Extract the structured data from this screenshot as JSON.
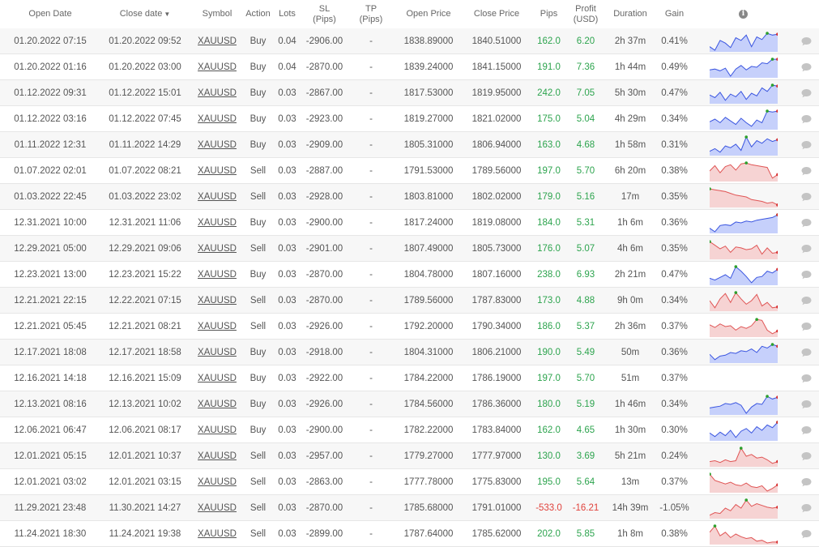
{
  "headers": {
    "open_date": "Open Date",
    "close_date": "Close date",
    "sort_arrow": "▼",
    "symbol": "Symbol",
    "action": "Action",
    "lots": "Lots",
    "sl": "SL",
    "sl_unit": "(Pips)",
    "tp": "TP",
    "tp_unit": "(Pips)",
    "open_price": "Open Price",
    "close_price": "Close Price",
    "pips": "Pips",
    "profit": "Profit",
    "profit_unit": "(USD)",
    "duration": "Duration",
    "gain": "Gain",
    "info_icon": "i"
  },
  "colors": {
    "profit_positive": "#2da44e",
    "profit_negative": "#e0413b",
    "buy_spark_line": "#3a55e0",
    "buy_spark_fill": "#c6d0fb",
    "sell_spark_line": "#e05555",
    "sell_spark_fill": "#f6d3d3",
    "spark_max_point": "#2ca02c",
    "spark_end_point": "#d62728",
    "comment_icon": "#c4c4c4"
  },
  "trades": [
    {
      "open": "01.20.2022 07:15",
      "close": "01.20.2022 09:52",
      "symbol": "XAUUSD",
      "action": "Buy",
      "lots": "0.04",
      "sl": "-2906.00",
      "tp": "-",
      "open_price": "1838.89000",
      "close_price": "1840.51000",
      "pips": "162.0",
      "profit": "6.20",
      "duration": "2h 37m",
      "gain": "0.41%",
      "spark": [
        0.2,
        0.0,
        0.55,
        0.4,
        0.15,
        0.7,
        0.55,
        0.85,
        0.2,
        0.75,
        0.6,
        0.95,
        0.85,
        0.9
      ]
    },
    {
      "open": "01.20.2022 01:16",
      "close": "01.20.2022 03:00",
      "symbol": "XAUUSD",
      "action": "Buy",
      "lots": "0.04",
      "sl": "-2870.00",
      "tp": "-",
      "open_price": "1839.24000",
      "close_price": "1841.15000",
      "pips": "191.0",
      "profit": "7.36",
      "duration": "1h 44m",
      "gain": "0.49%",
      "spark": [
        0.35,
        0.4,
        0.3,
        0.45,
        0.0,
        0.4,
        0.6,
        0.35,
        0.55,
        0.5,
        0.75,
        0.7,
        0.95,
        0.95
      ]
    },
    {
      "open": "01.12.2022 09:31",
      "close": "01.12.2022 15:01",
      "symbol": "XAUUSD",
      "action": "Buy",
      "lots": "0.03",
      "sl": "-2867.00",
      "tp": "-",
      "open_price": "1817.53000",
      "close_price": "1819.95000",
      "pips": "242.0",
      "profit": "7.05",
      "duration": "5h 30m",
      "gain": "0.47%",
      "spark": [
        0.4,
        0.25,
        0.55,
        0.1,
        0.45,
        0.3,
        0.6,
        0.15,
        0.5,
        0.35,
        0.8,
        0.6,
        0.95,
        0.9
      ]
    },
    {
      "open": "01.12.2022 03:16",
      "close": "01.12.2022 07:45",
      "symbol": "XAUUSD",
      "action": "Buy",
      "lots": "0.03",
      "sl": "-2923.00",
      "tp": "-",
      "open_price": "1819.27000",
      "close_price": "1821.02000",
      "pips": "175.0",
      "profit": "5.04",
      "duration": "4h 29m",
      "gain": "0.34%",
      "spark": [
        0.35,
        0.5,
        0.3,
        0.6,
        0.4,
        0.2,
        0.55,
        0.3,
        0.1,
        0.45,
        0.3,
        0.95,
        0.9,
        0.95
      ]
    },
    {
      "open": "01.11.2022 12:31",
      "close": "01.11.2022 14:29",
      "symbol": "XAUUSD",
      "action": "Buy",
      "lots": "0.03",
      "sl": "-2909.00",
      "tp": "-",
      "open_price": "1805.31000",
      "close_price": "1806.94000",
      "pips": "163.0",
      "profit": "4.68",
      "duration": "1h 58m",
      "gain": "0.31%",
      "spark": [
        0.15,
        0.3,
        0.1,
        0.45,
        0.35,
        0.55,
        0.2,
        0.95,
        0.4,
        0.75,
        0.6,
        0.85,
        0.7,
        0.8
      ]
    },
    {
      "open": "01.07.2022 02:01",
      "close": "01.07.2022 08:21",
      "symbol": "XAUUSD",
      "action": "Sell",
      "lots": "0.03",
      "sl": "-2887.00",
      "tp": "-",
      "open_price": "1791.53000",
      "close_price": "1789.56000",
      "pips": "197.0",
      "profit": "5.70",
      "duration": "6h 20m",
      "gain": "0.38%",
      "spark": [
        0.5,
        0.8,
        0.4,
        0.75,
        0.85,
        0.55,
        0.9,
        0.95,
        0.85,
        0.8,
        0.75,
        0.7,
        0.1,
        0.3
      ]
    },
    {
      "open": "01.03.2022 22:45",
      "close": "01.03.2022 23:02",
      "symbol": "XAUUSD",
      "action": "Sell",
      "lots": "0.03",
      "sl": "-2928.00",
      "tp": "-",
      "open_price": "1803.81000",
      "close_price": "1802.02000",
      "pips": "179.0",
      "profit": "5.16",
      "duration": "17m",
      "gain": "0.35%",
      "spark": [
        0.95,
        0.9,
        0.85,
        0.8,
        0.7,
        0.6,
        0.55,
        0.5,
        0.35,
        0.3,
        0.25,
        0.15,
        0.2,
        0.05
      ]
    },
    {
      "open": "12.31.2021 10:00",
      "close": "12.31.2021 11:06",
      "symbol": "XAUUSD",
      "action": "Buy",
      "lots": "0.03",
      "sl": "-2900.00",
      "tp": "-",
      "open_price": "1817.24000",
      "close_price": "1819.08000",
      "pips": "184.0",
      "profit": "5.31",
      "duration": "1h 6m",
      "gain": "0.36%",
      "spark": [
        0.2,
        0.0,
        0.35,
        0.4,
        0.35,
        0.55,
        0.5,
        0.6,
        0.55,
        0.65,
        0.7,
        0.75,
        0.8,
        0.95
      ]
    },
    {
      "open": "12.29.2021 05:00",
      "close": "12.29.2021 09:06",
      "symbol": "XAUUSD",
      "action": "Sell",
      "lots": "0.03",
      "sl": "-2901.00",
      "tp": "-",
      "open_price": "1807.49000",
      "close_price": "1805.73000",
      "pips": "176.0",
      "profit": "5.07",
      "duration": "4h 6m",
      "gain": "0.35%",
      "spark": [
        0.9,
        0.7,
        0.5,
        0.65,
        0.3,
        0.6,
        0.55,
        0.45,
        0.5,
        0.7,
        0.2,
        0.55,
        0.25,
        0.3
      ]
    },
    {
      "open": "12.23.2021 13:00",
      "close": "12.23.2021 15:22",
      "symbol": "XAUUSD",
      "action": "Buy",
      "lots": "0.03",
      "sl": "-2870.00",
      "tp": "-",
      "open_price": "1804.78000",
      "close_price": "1807.16000",
      "pips": "238.0",
      "profit": "6.93",
      "duration": "2h 21m",
      "gain": "0.47%",
      "spark": [
        0.3,
        0.2,
        0.35,
        0.5,
        0.3,
        0.95,
        0.7,
        0.4,
        0.05,
        0.35,
        0.4,
        0.7,
        0.6,
        0.8
      ]
    },
    {
      "open": "12.21.2021 22:15",
      "close": "12.22.2021 07:15",
      "symbol": "XAUUSD",
      "action": "Sell",
      "lots": "0.03",
      "sl": "-2870.00",
      "tp": "-",
      "open_price": "1789.56000",
      "close_price": "1787.83000",
      "pips": "173.0",
      "profit": "4.88",
      "duration": "9h 0m",
      "gain": "0.34%",
      "spark": [
        0.5,
        0.1,
        0.6,
        0.9,
        0.4,
        0.95,
        0.6,
        0.3,
        0.5,
        0.85,
        0.2,
        0.4,
        0.1,
        0.15
      ]
    },
    {
      "open": "12.21.2021 05:45",
      "close": "12.21.2021 08:21",
      "symbol": "XAUUSD",
      "action": "Sell",
      "lots": "0.03",
      "sl": "-2926.00",
      "tp": "-",
      "open_price": "1792.20000",
      "close_price": "1790.34000",
      "pips": "186.0",
      "profit": "5.37",
      "duration": "2h 36m",
      "gain": "0.37%",
      "spark": [
        0.6,
        0.45,
        0.65,
        0.5,
        0.55,
        0.3,
        0.5,
        0.4,
        0.55,
        0.9,
        0.85,
        0.3,
        0.1,
        0.25
      ]
    },
    {
      "open": "12.17.2021 18:08",
      "close": "12.17.2021 18:58",
      "symbol": "XAUUSD",
      "action": "Buy",
      "lots": "0.03",
      "sl": "-2918.00",
      "tp": "-",
      "open_price": "1804.31000",
      "close_price": "1806.21000",
      "pips": "190.0",
      "profit": "5.49",
      "duration": "50m",
      "gain": "0.36%",
      "spark": [
        0.4,
        0.1,
        0.3,
        0.35,
        0.5,
        0.45,
        0.6,
        0.55,
        0.7,
        0.5,
        0.85,
        0.75,
        0.95,
        0.85
      ]
    },
    {
      "open": "12.16.2021 14:18",
      "close": "12.16.2021 15:09",
      "symbol": "XAUUSD",
      "action": "Buy",
      "lots": "0.03",
      "sl": "-2922.00",
      "tp": "-",
      "open_price": "1784.22000",
      "close_price": "1786.19000",
      "pips": "197.0",
      "profit": "5.70",
      "duration": "51m",
      "gain": "0.37%",
      "spark": null
    },
    {
      "open": "12.13.2021 08:16",
      "close": "12.13.2021 10:02",
      "symbol": "XAUUSD",
      "action": "Buy",
      "lots": "0.03",
      "sl": "-2926.00",
      "tp": "-",
      "open_price": "1784.56000",
      "close_price": "1786.36000",
      "pips": "180.0",
      "profit": "5.19",
      "duration": "1h 46m",
      "gain": "0.34%",
      "spark": [
        0.3,
        0.35,
        0.4,
        0.55,
        0.5,
        0.6,
        0.45,
        0.0,
        0.35,
        0.55,
        0.5,
        0.95,
        0.8,
        0.9
      ]
    },
    {
      "open": "12.06.2021 06:47",
      "close": "12.06.2021 08:17",
      "symbol": "XAUUSD",
      "action": "Buy",
      "lots": "0.03",
      "sl": "-2900.00",
      "tp": "-",
      "open_price": "1782.22000",
      "close_price": "1783.84000",
      "pips": "162.0",
      "profit": "4.65",
      "duration": "1h 30m",
      "gain": "0.30%",
      "spark": [
        0.35,
        0.15,
        0.4,
        0.2,
        0.5,
        0.1,
        0.45,
        0.6,
        0.35,
        0.7,
        0.5,
        0.8,
        0.65,
        0.95
      ]
    },
    {
      "open": "12.01.2021 05:15",
      "close": "12.01.2021 10:37",
      "symbol": "XAUUSD",
      "action": "Sell",
      "lots": "0.03",
      "sl": "-2957.00",
      "tp": "-",
      "open_price": "1779.27000",
      "close_price": "1777.97000",
      "pips": "130.0",
      "profit": "3.69",
      "duration": "5h 21m",
      "gain": "0.24%",
      "spark": [
        0.2,
        0.25,
        0.15,
        0.3,
        0.2,
        0.25,
        0.95,
        0.5,
        0.6,
        0.4,
        0.45,
        0.3,
        0.1,
        0.2
      ]
    },
    {
      "open": "12.01.2021 03:02",
      "close": "12.01.2021 03:15",
      "symbol": "XAUUSD",
      "action": "Sell",
      "lots": "0.03",
      "sl": "-2863.00",
      "tp": "-",
      "open_price": "1777.78000",
      "close_price": "1775.83000",
      "pips": "195.0",
      "profit": "5.64",
      "duration": "13m",
      "gain": "0.37%",
      "spark": [
        0.95,
        0.6,
        0.5,
        0.4,
        0.5,
        0.35,
        0.3,
        0.45,
        0.25,
        0.2,
        0.3,
        0.0,
        0.15,
        0.35
      ]
    },
    {
      "open": "11.29.2021 23:48",
      "close": "11.30.2021 14:27",
      "symbol": "XAUUSD",
      "action": "Sell",
      "lots": "0.03",
      "sl": "-2870.00",
      "tp": "-",
      "open_price": "1785.68000",
      "close_price": "1791.01000",
      "pips": "-533.0",
      "profit": "-16.21",
      "duration": "14h 39m",
      "gain": "-1.05%",
      "spark": [
        0.1,
        0.25,
        0.2,
        0.5,
        0.35,
        0.7,
        0.5,
        0.95,
        0.6,
        0.75,
        0.65,
        0.55,
        0.5,
        0.55
      ]
    },
    {
      "open": "11.24.2021 18:30",
      "close": "11.24.2021 19:38",
      "symbol": "XAUUSD",
      "action": "Sell",
      "lots": "0.03",
      "sl": "-2899.00",
      "tp": "-",
      "open_price": "1787.64000",
      "close_price": "1785.62000",
      "pips": "202.0",
      "profit": "5.85",
      "duration": "1h 8m",
      "gain": "0.38%",
      "spark": [
        0.6,
        0.95,
        0.4,
        0.6,
        0.3,
        0.5,
        0.35,
        0.25,
        0.3,
        0.1,
        0.15,
        0.0,
        0.05,
        0.05
      ]
    }
  ]
}
